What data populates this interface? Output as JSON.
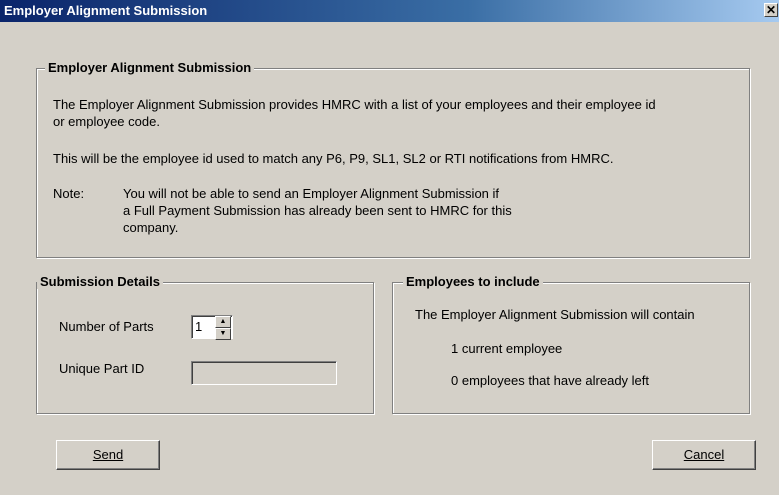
{
  "window": {
    "title": "Employer Alignment Submission",
    "close_glyph": "✕"
  },
  "info_group": {
    "legend": "Employer Alignment Submission",
    "line1": "The Employer Alignment Submission provides HMRC with a list of your employees and their employee id",
    "line2": "or employee code.",
    "line3": "This will be the employee id used to match any P6, P9, SL1, SL2 or RTI notifications from HMRC.",
    "note_label": "Note:",
    "note_line1": "You will not be able to send an Employer Alignment Submission if",
    "note_line2": "a Full Payment Submission has already been sent to HMRC for this",
    "note_line3": "company."
  },
  "details_group": {
    "legend": "Submission Details",
    "parts_label": "Number of Parts",
    "parts_value": "1",
    "unique_id_label": "Unique Part ID",
    "unique_id_value": ""
  },
  "employees_group": {
    "legend": "Employees to include",
    "line1": "The Employer Alignment Submission will contain",
    "line2": "1 current employee",
    "line3": "0 employees that have already left"
  },
  "buttons": {
    "send": "Send",
    "cancel": "Cancel"
  }
}
